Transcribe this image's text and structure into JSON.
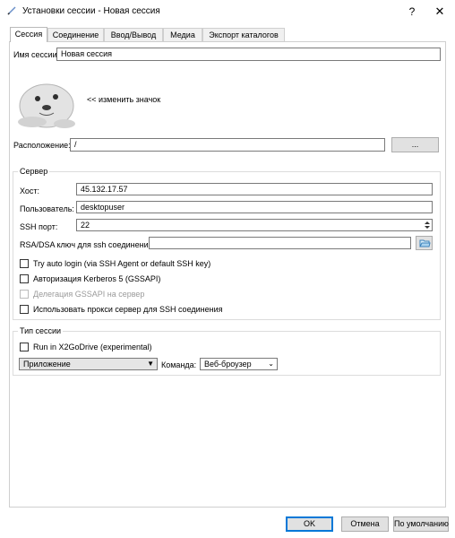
{
  "window": {
    "title": "Установки сессии - Новая сессия",
    "help_symbol": "?",
    "close_symbol": "✕"
  },
  "tabs": [
    {
      "label": "Сессия"
    },
    {
      "label": "Соединение"
    },
    {
      "label": "Ввод/Вывод"
    },
    {
      "label": "Медиа"
    },
    {
      "label": "Экспорт каталогов"
    }
  ],
  "session": {
    "name_label": "Имя сессии:",
    "name_value": "Новая сессия",
    "change_icon_label": "<< изменить значок",
    "location_label": "Расположение:",
    "location_value": "/",
    "browse_label": "..."
  },
  "server": {
    "group_title": "Сервер",
    "host_label": "Хост:",
    "host_value": "45.132.17.57",
    "user_label": "Пользователь:",
    "user_value": "desktopuser",
    "ssh_port_label": "SSH порт:",
    "ssh_port_value": "22",
    "key_label": "RSA/DSA ключ для ssh соединения:",
    "key_value": "",
    "auto_login_label": "Try auto login (via SSH Agent or default SSH key)",
    "kerberos_label": "Авторизация Kerberos 5 (GSSAPI)",
    "gssapi_label": "Делегация GSSAPI на сервер",
    "proxy_label": "Использовать прокси сервер для SSH соединения"
  },
  "session_type": {
    "group_title": "Тип сессии",
    "x2godrive_label": "Run in X2GoDrive (experimental)",
    "type_value": "Приложение",
    "command_label": "Команда:",
    "command_value": "Веб-броузер"
  },
  "footer": {
    "ok_label": "OK",
    "cancel_label": "Отмена",
    "default_label": "По умолчанию"
  },
  "icons": {
    "title": "pen-icon",
    "session": "seal-mascot-icon",
    "browse_key": "folder-open-icon",
    "dropdown": "chevron-down-icon",
    "spin": "spinner-arrows-icon"
  }
}
